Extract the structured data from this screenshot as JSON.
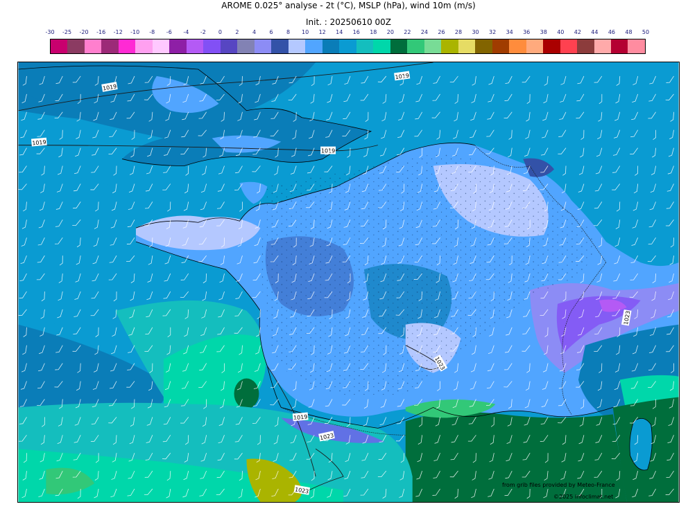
{
  "header": {
    "title": "AROME 0.025° analyse - 2t (°C), MSLP (hPa), wind 10m (m/s)",
    "init": "Init. : 20250610 00Z"
  },
  "legend": {
    "ticks": [
      "-30",
      "-25",
      "-20",
      "-16",
      "-12",
      "-10",
      "-8",
      "-6",
      "-4",
      "-2",
      "0",
      "2",
      "4",
      "6",
      "8",
      "10",
      "12",
      "14",
      "16",
      "18",
      "20",
      "22",
      "24",
      "26",
      "28",
      "30",
      "32",
      "34",
      "36",
      "38",
      "40",
      "42",
      "44",
      "46",
      "48",
      "50"
    ],
    "colors": [
      "#c8006e",
      "#8b3b62",
      "#ff7fce",
      "#9c2a78",
      "#ff2ad4",
      "#ffa0f0",
      "#ffc8ff",
      "#8e1fa6",
      "#b45af5",
      "#8250f5",
      "#5746c2",
      "#8282b4",
      "#8c8cf5",
      "#3352a8",
      "#b4c8ff",
      "#51a5ff",
      "#0a7db8",
      "#0a9bd2",
      "#14bebe",
      "#00d7aa",
      "#006e3c",
      "#32c878",
      "#78dc96",
      "#aab400",
      "#e6dc64",
      "#826400",
      "#a03c00",
      "#ff8c3c",
      "#ffaa7d",
      "#aa0000",
      "#ff4150",
      "#8c3c3c",
      "#ffaaaa",
      "#b40032",
      "#ff8ca0"
    ]
  },
  "map": {
    "isobars": [
      {
        "label": "1019"
      },
      {
        "label": "1019"
      },
      {
        "label": "1019"
      },
      {
        "label": "1019"
      },
      {
        "label": "1019"
      },
      {
        "label": "1023"
      },
      {
        "label": "1023"
      },
      {
        "label": "1023"
      },
      {
        "label": "1023"
      }
    ]
  },
  "credits": {
    "line1": "from grib files provided by Meteo-France",
    "line2": "©2025 infoclimat.net"
  }
}
